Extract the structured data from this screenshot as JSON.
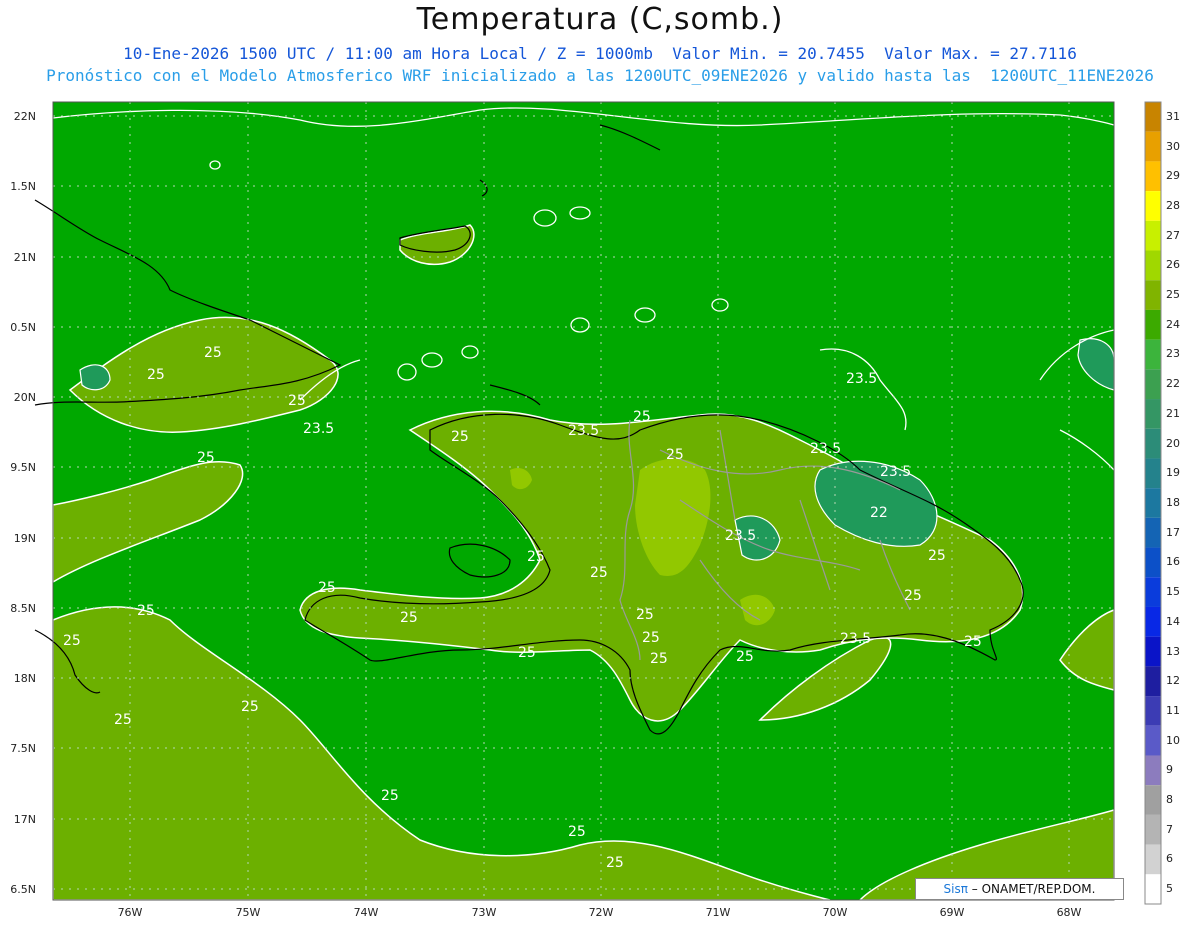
{
  "header": {
    "title": "Temperatura (C,somb.)",
    "line1": "10-Ene-2026 1500 UTC / 11:00 am Hora Local / Z = 1000mb  Valor Min. = 20.7455  Valor Max. = 27.7116",
    "line2": "Pronóstico con el Modelo Atmosferico WRF inicializado a las 1200UTC_09ENE2026 y valido hasta las  1200UTC_11ENE2026"
  },
  "axes": {
    "lat_labels": [
      "22N",
      "1.5N",
      "21N",
      "0.5N",
      "20N",
      "9.5N",
      "19N",
      "8.5N",
      "18N",
      "7.5N",
      "17N",
      "6.5N"
    ],
    "lon_labels": [
      "76W",
      "75W",
      "74W",
      "73W",
      "72W",
      "71W",
      "70W",
      "69W",
      "68W"
    ]
  },
  "colorbar": {
    "labels": [
      "31",
      "30",
      "29",
      "28",
      "27",
      "26",
      "25",
      "24",
      "23",
      "22",
      "21",
      "20",
      "19",
      "18",
      "17",
      "16",
      "15",
      "14",
      "13",
      "12",
      "11",
      "10",
      "9",
      "8",
      "7",
      "6",
      "5"
    ],
    "colors": [
      "#c88400",
      "#e8a000",
      "#ffc000",
      "#ffff00",
      "#c8f000",
      "#a0d800",
      "#80b400",
      "#3caa00",
      "#3cb43c",
      "#3ca050",
      "#349664",
      "#2c8c78",
      "#24828c",
      "#1c78a0",
      "#1464b4",
      "#0c50c8",
      "#0a3cdc",
      "#0828e6",
      "#0a14c8",
      "#1e1ea0",
      "#3c3cb4",
      "#5a5ac8",
      "#8c7cbe",
      "#a0a0a0",
      "#b4b4b4",
      "#d2d2d2",
      "#ffffff"
    ]
  },
  "field": {
    "background_color": "#00a800",
    "warm_color": "#6cb000",
    "hot_color": "#92c800",
    "cool_color": "#1f9a5a"
  },
  "contour_labels": [
    "25",
    "25",
    "25",
    "25",
    "23.5",
    "25",
    "23.5",
    "25",
    "25",
    "23.5",
    "23.5",
    "23.5",
    "22",
    "25",
    "25",
    "25",
    "25",
    "25",
    "25",
    "25",
    "25",
    "23.5",
    "25",
    "25",
    "25",
    "25",
    "25",
    "25",
    "25",
    "25",
    "23.5",
    "25",
    "25",
    "25"
  ],
  "credit": {
    "brand": "Sisπ",
    "text": "– ONAMET/REP.DOM."
  }
}
